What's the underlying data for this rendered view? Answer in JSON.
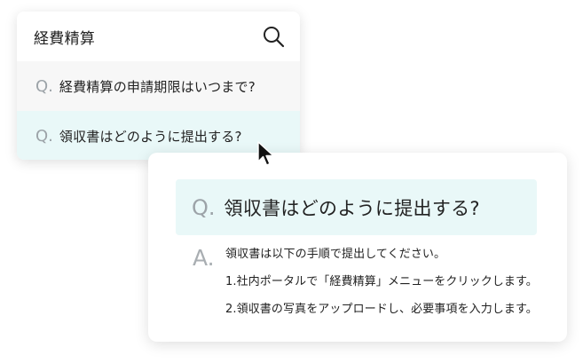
{
  "search": {
    "query": "経費精算",
    "icon": "search-icon"
  },
  "suggestions": [
    {
      "prefix": "Q.",
      "text": "経費精算の申請期限はいつまで?"
    },
    {
      "prefix": "Q.",
      "text": "領収書はどのように提出する?"
    }
  ],
  "answer_card": {
    "question_prefix": "Q.",
    "question": "領収書はどのように提出する?",
    "answer_prefix": "A.",
    "answer_lines": [
      "領収書は以下の手順で提出してください。",
      "1.社内ポータルで「経費精算」メニューをクリックします。",
      "2.領収書の写真をアップロードし、必要事項を入力します。"
    ]
  },
  "colors": {
    "highlight": "#e9f8f8",
    "muted_prefix": "#9ca3a8",
    "hover_row": "#f7f7f7"
  }
}
